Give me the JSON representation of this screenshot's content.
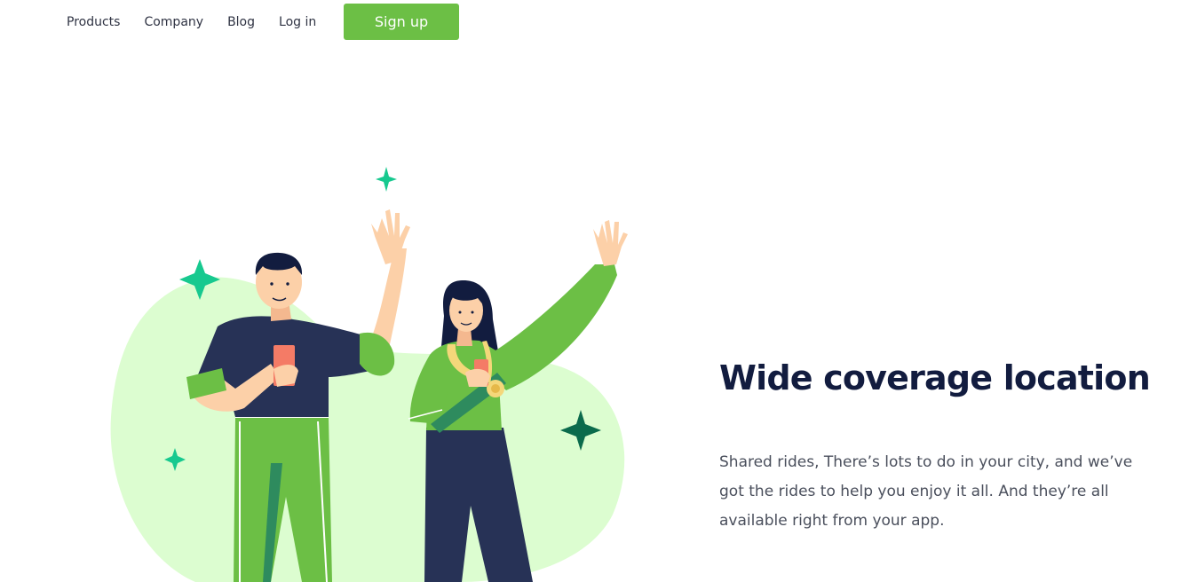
{
  "nav": {
    "items": [
      {
        "label": "Products"
      },
      {
        "label": "Company"
      },
      {
        "label": "Blog"
      },
      {
        "label": "Log in"
      }
    ],
    "signup_label": "Sign up"
  },
  "hero": {
    "title": "Wide coverage location",
    "description": "Shared rides, There’s lots to do in your city, and we’ve got the rides to help you enjoy it all. And they’re all available right from your app."
  },
  "colors": {
    "accent_green": "#6cbf45",
    "blob_green": "#dcfdd0",
    "navy": "#121c3f",
    "sparkle_light": "#17c98f",
    "sparkle_dark": "#0b6b4c"
  }
}
